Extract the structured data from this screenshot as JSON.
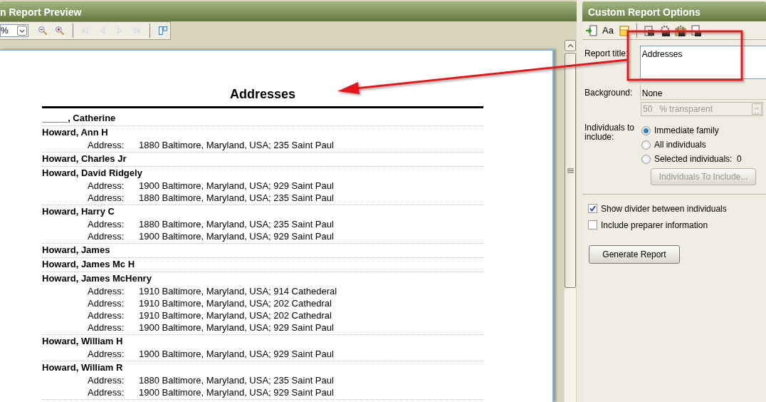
{
  "preview": {
    "title": "n Report Preview",
    "zoom_value": "%",
    "toolbar": [
      {
        "kind": "zoom-out"
      },
      {
        "kind": "zoom-in"
      },
      {
        "kind": "sep"
      },
      {
        "kind": "first",
        "disabled": true
      },
      {
        "kind": "prev",
        "disabled": true
      },
      {
        "kind": "next",
        "disabled": true
      },
      {
        "kind": "last",
        "disabled": true
      },
      {
        "kind": "sep"
      },
      {
        "kind": "layout"
      }
    ]
  },
  "report": {
    "title": "Addresses",
    "entries": [
      {
        "name": "_____, Catherine"
      },
      {
        "name": "Howard, Ann H",
        "addresses": [
          {
            "label": "Address:",
            "value": "1880 Baltimore, Maryland, USA; 235 Saint Paul"
          }
        ]
      },
      {
        "name": "Howard, Charles Jr"
      },
      {
        "name": "Howard, David Ridgely",
        "addresses": [
          {
            "label": "Address:",
            "value": "1900 Baltimore, Maryland, USA; 929 Saint Paul"
          },
          {
            "label": "Address:",
            "value": "1880 Baltimore, Maryland, USA; 235 Saint Paul"
          }
        ]
      },
      {
        "name": "Howard, Harry C",
        "addresses": [
          {
            "label": "Address:",
            "value": "1880 Baltimore, Maryland, USA; 235 Saint Paul"
          },
          {
            "label": "Address:",
            "value": "1900 Baltimore, Maryland, USA; 929 Saint Paul"
          }
        ]
      },
      {
        "name": "Howard, James"
      },
      {
        "name": "Howard, James Mc H"
      },
      {
        "name": "Howard, James McHenry",
        "addresses": [
          {
            "label": "Address:",
            "value": "1910 Baltimore, Maryland, USA; 914 Cathederal"
          },
          {
            "label": "Address:",
            "value": "1910 Baltimore, Maryland, USA; 202 Cathedral"
          },
          {
            "label": "Address:",
            "value": "1910 Baltimore, Maryland, USA; 202 Cathedral"
          },
          {
            "label": "Address:",
            "value": "1900 Baltimore, Maryland, USA; 929 Saint Paul"
          }
        ]
      },
      {
        "name": "Howard, William H",
        "addresses": [
          {
            "label": "Address:",
            "value": "1900 Baltimore, Maryland, USA; 929 Saint Paul"
          }
        ]
      },
      {
        "name": "Howard, William R",
        "addresses": [
          {
            "label": "Address:",
            "value": "1880 Baltimore, Maryland, USA; 235 Saint Paul"
          },
          {
            "label": "Address:",
            "value": "1900 Baltimore, Maryland, USA; 929 Saint Paul"
          }
        ]
      }
    ]
  },
  "options": {
    "title": "Custom Report Options",
    "toolbar": [
      {
        "kind": "export"
      },
      {
        "kind": "font",
        "text": "Aa"
      },
      {
        "kind": "folder"
      },
      {
        "kind": "sep"
      },
      {
        "kind": "page"
      },
      {
        "kind": "gear"
      },
      {
        "kind": "gear-folder"
      },
      {
        "kind": "doc-gear"
      }
    ],
    "report_title_label": "Report title:",
    "report_title": "Addresses",
    "background_label": "Background:",
    "background": "None",
    "transparency": {
      "value": "50",
      "suffix": "% transparent",
      "disabled": true
    },
    "individuals_label": "Individuals to include:",
    "radios": [
      {
        "label": "Immediate family",
        "selected": true
      },
      {
        "label": "All individuals",
        "selected": false
      },
      {
        "label": "Selected individuals:  0",
        "selected": false
      }
    ],
    "include_button": {
      "label": "Individuals To Include...",
      "disabled": true
    },
    "checkboxes": [
      {
        "label": "Show divider between individuals",
        "checked": true
      },
      {
        "label": "Include preparer information",
        "checked": false
      }
    ],
    "generate_button": "Generate Report"
  }
}
